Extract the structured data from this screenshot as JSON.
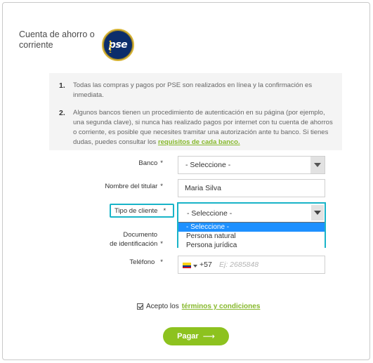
{
  "header": {
    "method_title": "Cuenta de ahorro o corriente",
    "logo_text": "pse"
  },
  "info": {
    "items": [
      {
        "number": "1.",
        "text": "Todas las compras y pagos por PSE son realizados en línea y la confirmación es inmediata."
      },
      {
        "number": "2.",
        "text": "Algunos bancos tienen un procedimiento de autenticación en su página (por ejemplo, una segunda clave), si nunca has realizado pagos por internet con tu cuenta de ahorros o corriente, es posible que necesites tramitar una autorización ante tu banco. Si tienes dudas, puedes consultar los",
        "link": "requisitos de cada banco."
      }
    ]
  },
  "form": {
    "bank": {
      "label": "Banco",
      "required_mark": "*",
      "value": "- Seleccione -"
    },
    "holder": {
      "label": "Nombre del titular",
      "required_mark": "*",
      "value": "Maria Silva"
    },
    "client_type": {
      "label": "Tipo de cliente",
      "required_mark": "*",
      "value": "- Seleccione -",
      "options": [
        "- Seleccione -",
        "Persona natural",
        "Persona jurídica"
      ]
    },
    "document": {
      "label_line1": "Documento",
      "label_line2": "de identificación",
      "required_mark": "*"
    },
    "phone": {
      "label": "Teléfono",
      "required_mark": "*",
      "country_flag": "colombia-flag-icon",
      "dial_code": "+57",
      "placeholder": "Ej: 2685848"
    },
    "terms": {
      "checked": true,
      "prefix": "Acepto los",
      "link": "términos y condiciones"
    },
    "submit": {
      "label": "Pagar",
      "arrow": "⟶"
    }
  },
  "colors": {
    "accent_green": "#8dc21f",
    "link_green": "#86b82b",
    "focus_cyan": "#19b4c8",
    "option_highlight": "#1e90ff",
    "pse_navy": "#0c2d6b"
  }
}
